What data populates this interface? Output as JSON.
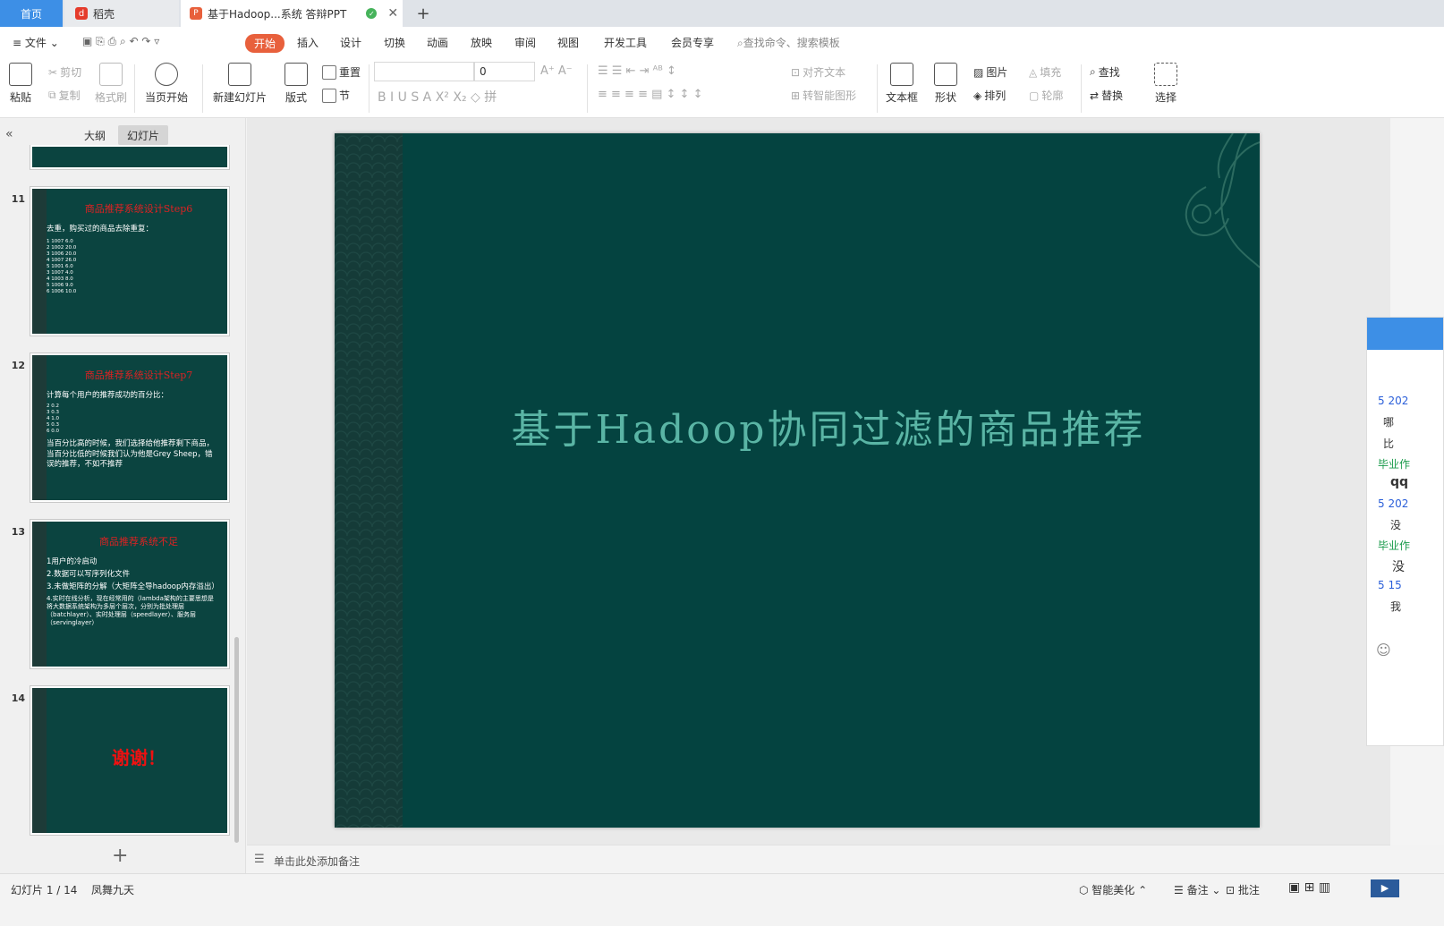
{
  "tabs": {
    "home": "首页",
    "daoke": "稻壳",
    "doc": "基于Hadoop...系统 答辩PPT"
  },
  "menu": {
    "file": "文件",
    "start": "开始",
    "insert": "插入",
    "design": "设计",
    "transition": "切换",
    "animation": "动画",
    "slideshow": "放映",
    "review": "审阅",
    "view": "视图",
    "devtools": "开发工具",
    "member": "会员专享",
    "search_placeholder": "查找命令、搜索模板"
  },
  "ribbon": {
    "paste": "粘贴",
    "cut": "剪切",
    "copy": "复制",
    "format_painter": "格式刷",
    "from_current": "当页开始",
    "new_slide": "新建幻灯片",
    "layout": "版式",
    "reset": "重置",
    "section": "节",
    "font_size": "0",
    "align_text": "对齐文本",
    "smart_art": "转智能图形",
    "textbox": "文本框",
    "shape": "形状",
    "picture": "图片",
    "fill": "填充",
    "arrange": "排列",
    "outline": "轮廓",
    "find": "查找",
    "replace": "替换",
    "select": "选择"
  },
  "panel": {
    "outline_tab": "大纲",
    "slides_tab": "幻灯片"
  },
  "thumbnails": [
    {
      "num": "11",
      "title": "商品推荐系统设计Step6",
      "body": "去重，购买过的商品去除重复：",
      "small": [
        "1 1007 6.0",
        "2 1002 20.0",
        "3 1006 20.0",
        "4 1007 26.0",
        "5 1001 6.0",
        "3 1007 4.0",
        "4 1003 8.0",
        "5 1006 9.0",
        "6 1006 10.0"
      ]
    },
    {
      "num": "12",
      "title": "商品推荐系统设计Step7",
      "body": "计算每个用户的推荐成功的百分比：",
      "small": [
        "2 0.2",
        "3 0.3",
        "4 1.0",
        "5 0.3",
        "6 0.0"
      ],
      "body2": "当百分比高的时候，我们选择给他推荐剩下商品，当百分比低的时候我们认为他是Grey Sheep，错误的推荐，不如不推荐"
    },
    {
      "num": "13",
      "title": "商品推荐系统不足",
      "lines": [
        "1用户的冷启动",
        "2.数据可以写序列化文件",
        "3.未做矩阵的分解（大矩阵全导hadoop内存溢出）",
        "4.实时在线分析，现在经常用的（lambda架构的主要思想是将大数据系统架构为多层个层次，分别为批处理层（batchlayer）、实时处理层（speedlayer）、服务层（servinglayer）"
      ]
    },
    {
      "num": "14",
      "title": "谢谢！"
    }
  ],
  "slide": {
    "title": "基于Hadoop协同过滤的商品推荐"
  },
  "popup": {
    "lines": [
      "5 202",
      "哪",
      "比",
      "毕业作",
      "qq",
      "5 202",
      "没",
      "毕业作",
      "没",
      "5  15",
      "我"
    ]
  },
  "notes": {
    "placeholder": "单击此处添加备注"
  },
  "status": {
    "slide_count": "幻灯片 1 / 14",
    "theme": "凤舞九天",
    "beautify": "智能美化",
    "notes": "备注",
    "comments": "批注"
  }
}
